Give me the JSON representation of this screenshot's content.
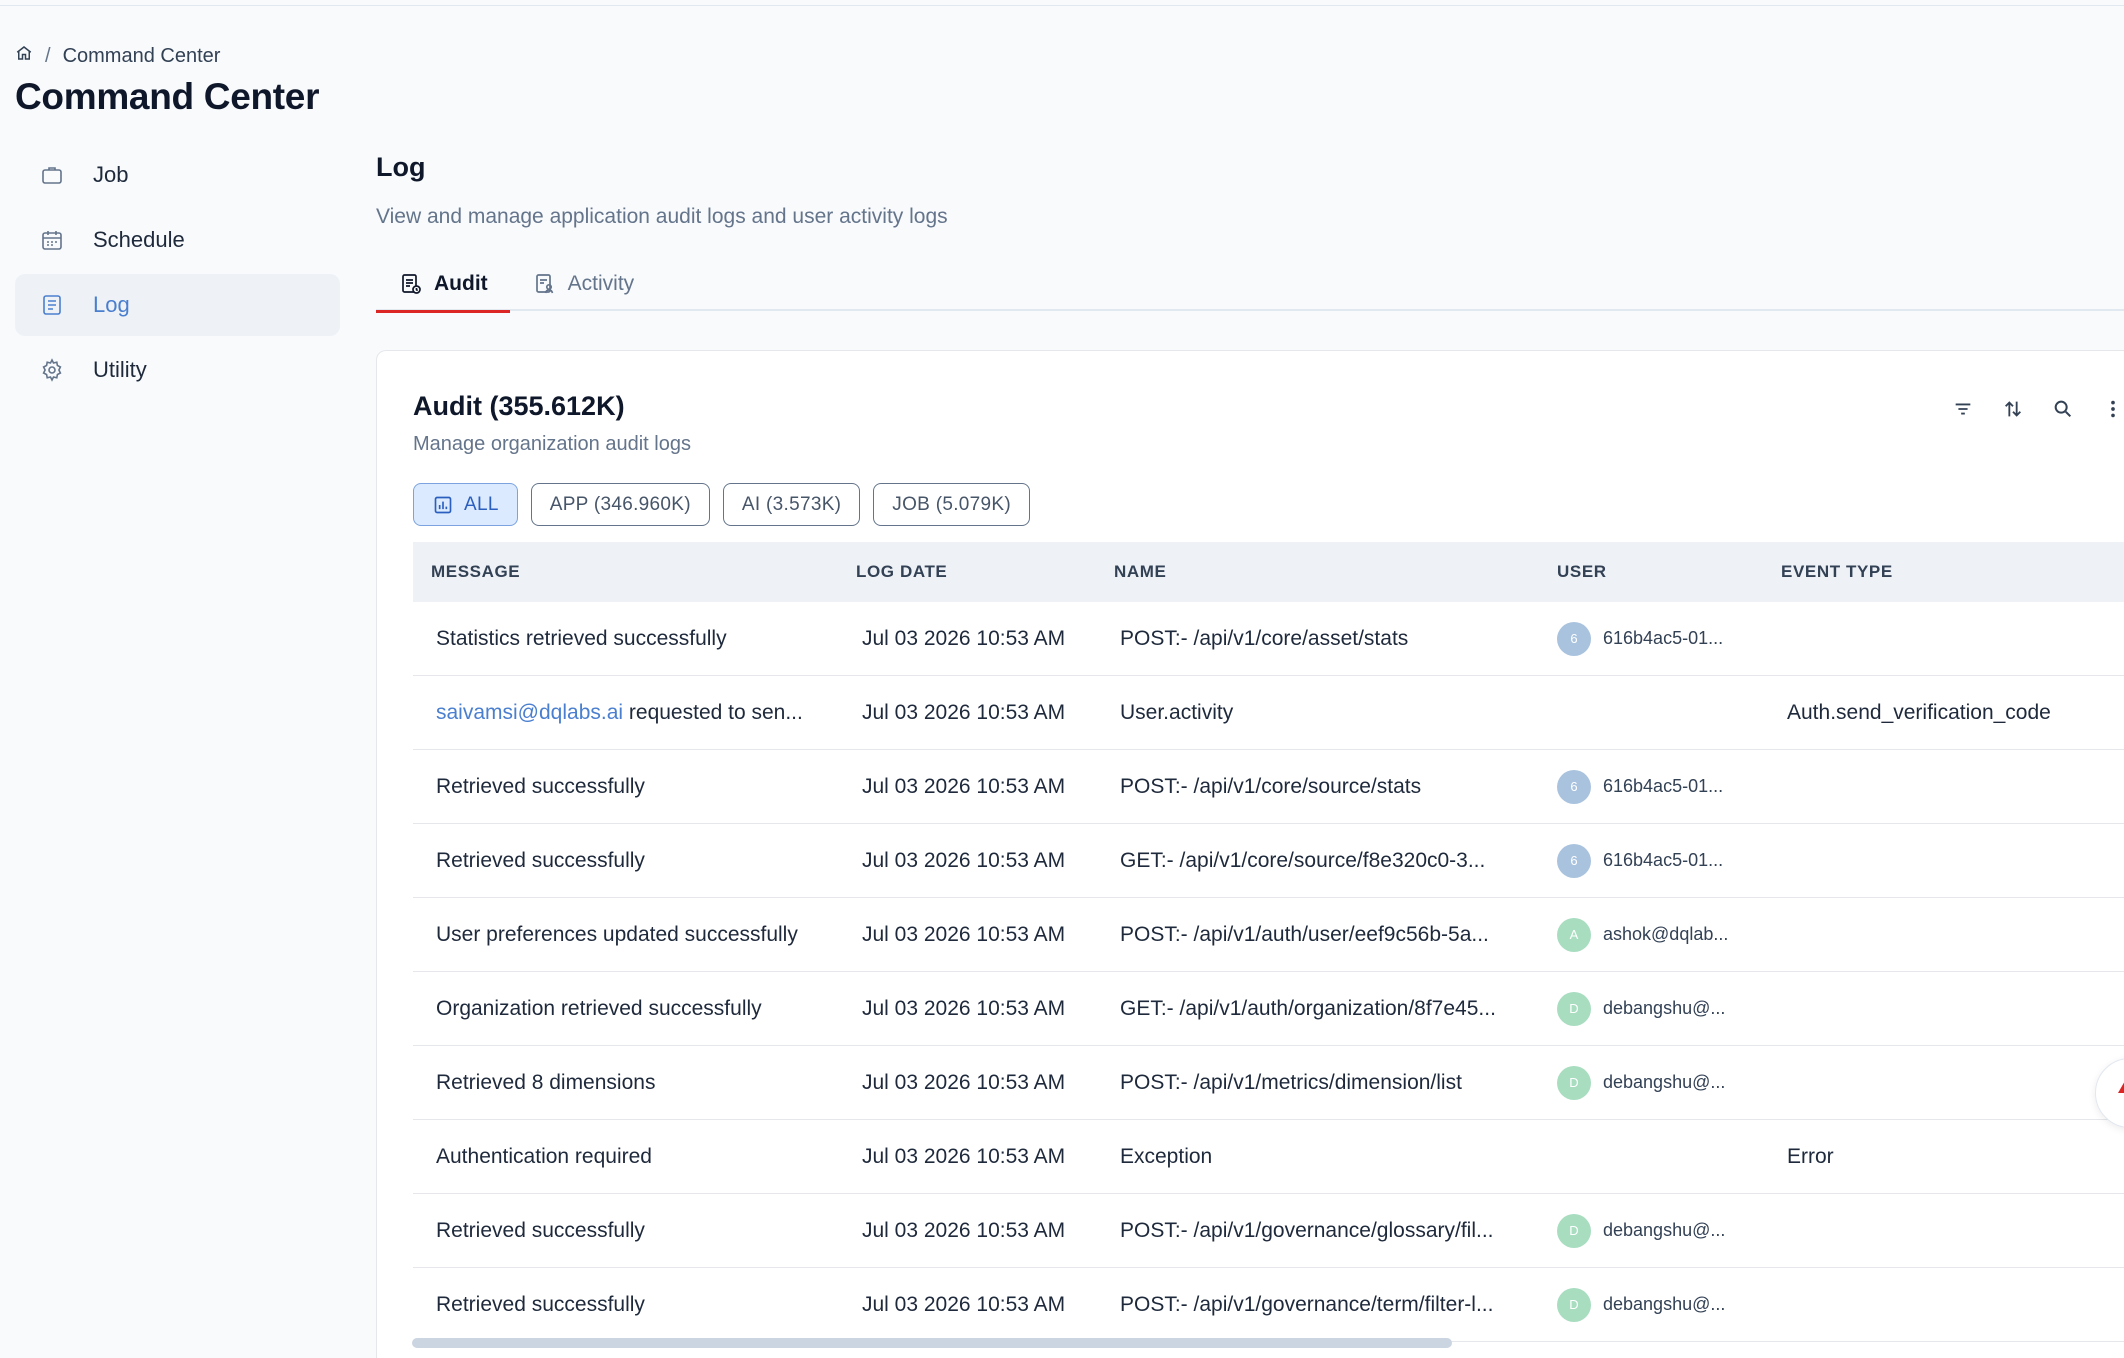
{
  "breadcrumb": {
    "current": "Command Center"
  },
  "page_title": "Command Center",
  "sidebar": {
    "items": [
      {
        "label": "Job",
        "icon": "briefcase-icon"
      },
      {
        "label": "Schedule",
        "icon": "calendar-icon"
      },
      {
        "label": "Log",
        "icon": "document-icon",
        "active": true
      },
      {
        "label": "Utility",
        "icon": "gear-icon"
      }
    ]
  },
  "main": {
    "title": "Log",
    "subtitle": "View and manage application audit logs and user activity logs",
    "tabs": [
      {
        "label": "Audit",
        "active": true
      },
      {
        "label": "Activity"
      }
    ]
  },
  "card": {
    "title": "Audit (355.612K)",
    "subtitle": "Manage organization audit logs",
    "chips": [
      {
        "label": "ALL",
        "active": true
      },
      {
        "label": "APP (346.960K)"
      },
      {
        "label": "AI (3.573K)"
      },
      {
        "label": "JOB (5.079K)"
      }
    ]
  },
  "table": {
    "headers": [
      "MESSAGE",
      "LOG DATE",
      "NAME",
      "USER",
      "EVENT TYPE"
    ],
    "rows": [
      {
        "message": "Statistics retrieved successfully",
        "date": "Jul 03 2026 10:53 AM",
        "name": "POST:- /api/v1/core/asset/stats",
        "avatar": "6",
        "user": "616b4ac5-01...",
        "event": ""
      },
      {
        "message_link": "saivamsi@dqlabs.ai",
        "message": " requested to sen...",
        "date": "Jul 03 2026 10:53 AM",
        "name": "User.activity",
        "avatar": "",
        "user": "",
        "event": "Auth.send_verification_code"
      },
      {
        "message": "Retrieved successfully",
        "date": "Jul 03 2026 10:53 AM",
        "name": "POST:- /api/v1/core/source/stats",
        "avatar": "6",
        "user": "616b4ac5-01...",
        "event": ""
      },
      {
        "message": "Retrieved successfully",
        "date": "Jul 03 2026 10:53 AM",
        "name": "GET:- /api/v1/core/source/f8e320c0-3...",
        "avatar": "6",
        "user": "616b4ac5-01...",
        "event": ""
      },
      {
        "message": "User preferences updated successfully",
        "date": "Jul 03 2026 10:53 AM",
        "name": "POST:- /api/v1/auth/user/eef9c56b-5a...",
        "avatar": "A",
        "user": "ashok@dqlab...",
        "event": ""
      },
      {
        "message": "Organization retrieved successfully",
        "date": "Jul 03 2026 10:53 AM",
        "name": "GET:- /api/v1/auth/organization/8f7e45...",
        "avatar": "D",
        "user": "debangshu@...",
        "event": ""
      },
      {
        "message": "Retrieved 8 dimensions",
        "date": "Jul 03 2026 10:53 AM",
        "name": "POST:- /api/v1/metrics/dimension/list",
        "avatar": "D",
        "user": "debangshu@...",
        "event": ""
      },
      {
        "message": "Authentication required",
        "date": "Jul 03 2026 10:53 AM",
        "name": "Exception",
        "avatar": "",
        "user": "",
        "event": "Error"
      },
      {
        "message": "Retrieved successfully",
        "date": "Jul 03 2026 10:53 AM",
        "name": "POST:- /api/v1/governance/glossary/fil...",
        "avatar": "D",
        "user": "debangshu@...",
        "event": ""
      },
      {
        "message": "Retrieved successfully",
        "date": "Jul 03 2026 10:53 AM",
        "name": "POST:- /api/v1/governance/term/filter-l...",
        "avatar": "D",
        "user": "debangshu@...",
        "event": ""
      }
    ]
  },
  "colors": {
    "accent": "#4a7fcf",
    "tab_underline": "#dc2626",
    "chip_active_bg": "#dbeafe"
  }
}
